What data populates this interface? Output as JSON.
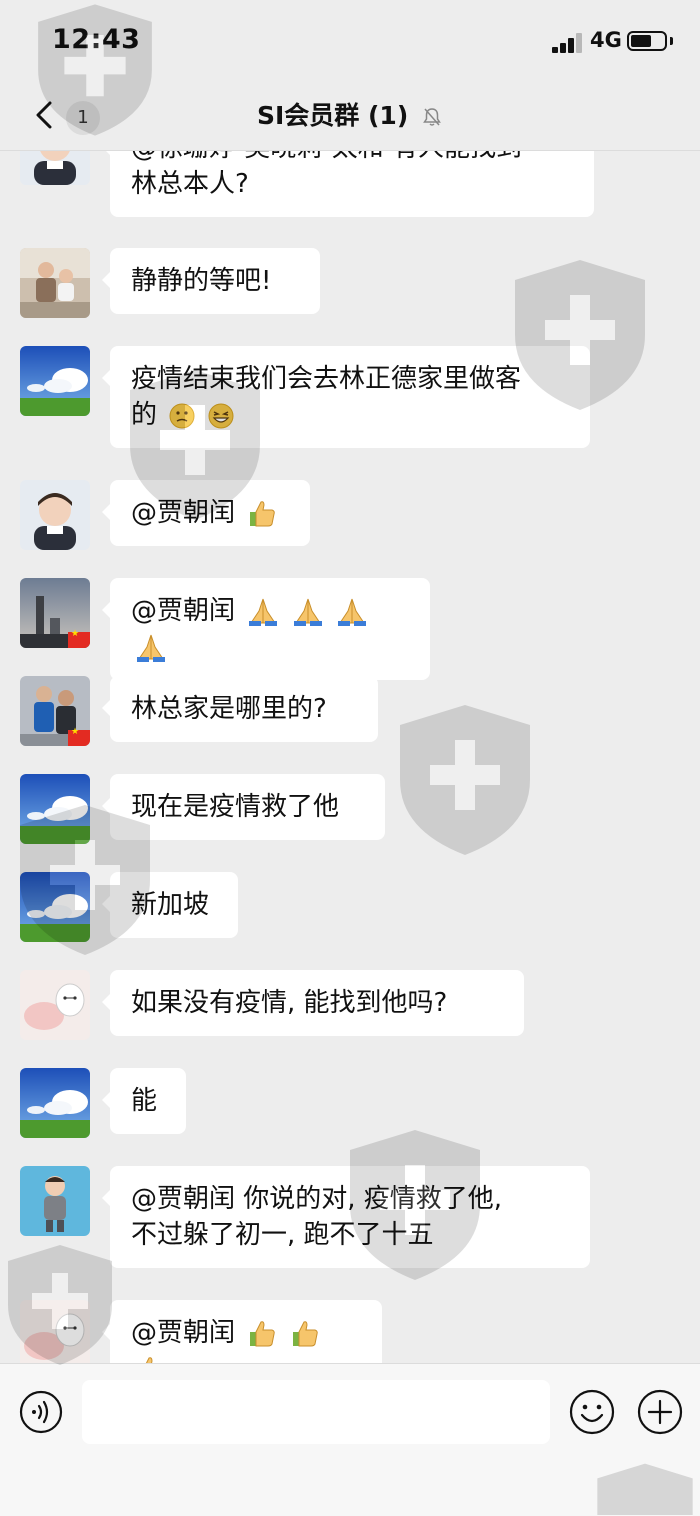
{
  "status_bar": {
    "time": "12:43",
    "network": "4G"
  },
  "nav": {
    "back_badge": "1",
    "title": "SI会员群 (1)"
  },
  "messages": [
    {
      "lines": [
        "@徐珊婷-吴晓莉-太和 有人能找到",
        "林总本人?"
      ],
      "avatar": "child-avatar"
    },
    {
      "lines": [
        "静静的等吧!"
      ],
      "avatar": "family-avatar"
    },
    {
      "lines": [
        "疫情结束我们会去林正德家里做客",
        "的"
      ],
      "avatar": "sky-avatar",
      "emoji": [
        "thinking-emoji",
        "grin-emoji"
      ]
    },
    {
      "lines": [
        "@贾朝闰"
      ],
      "avatar": "child-avatar",
      "emoji": [
        "thumbs-up-emoji"
      ]
    },
    {
      "lines": [
        "@贾朝闰"
      ],
      "avatar": "city-avatar",
      "emoji": [
        "pray-emoji",
        "pray-emoji",
        "pray-emoji",
        "pray-emoji"
      ]
    },
    {
      "lines": [
        "林总家是哪里的?"
      ],
      "avatar": "people-avatar"
    },
    {
      "lines": [
        "现在是疫情救了他"
      ],
      "avatar": "sky-avatar"
    },
    {
      "lines": [
        "新加坡"
      ],
      "avatar": "sky-avatar"
    },
    {
      "lines": [
        "如果没有疫情, 能找到他吗?"
      ],
      "avatar": "cartoon-avatar"
    },
    {
      "lines": [
        "能"
      ],
      "avatar": "sky-avatar"
    },
    {
      "lines": [
        "@贾朝闰 你说的对, 疫情救了他,",
        "不过躲了初一, 跑不了十五"
      ],
      "avatar": "boy-avatar"
    },
    {
      "lines": [
        "@贾朝闰"
      ],
      "avatar": "cartoon-avatar",
      "emoji": [
        "thumbs-up-emoji",
        "thumbs-up-emoji",
        "thumbs-up-emoji"
      ]
    }
  ],
  "colors": {
    "background": "#ededed",
    "bubble": "#ffffff",
    "text": "#111111"
  }
}
